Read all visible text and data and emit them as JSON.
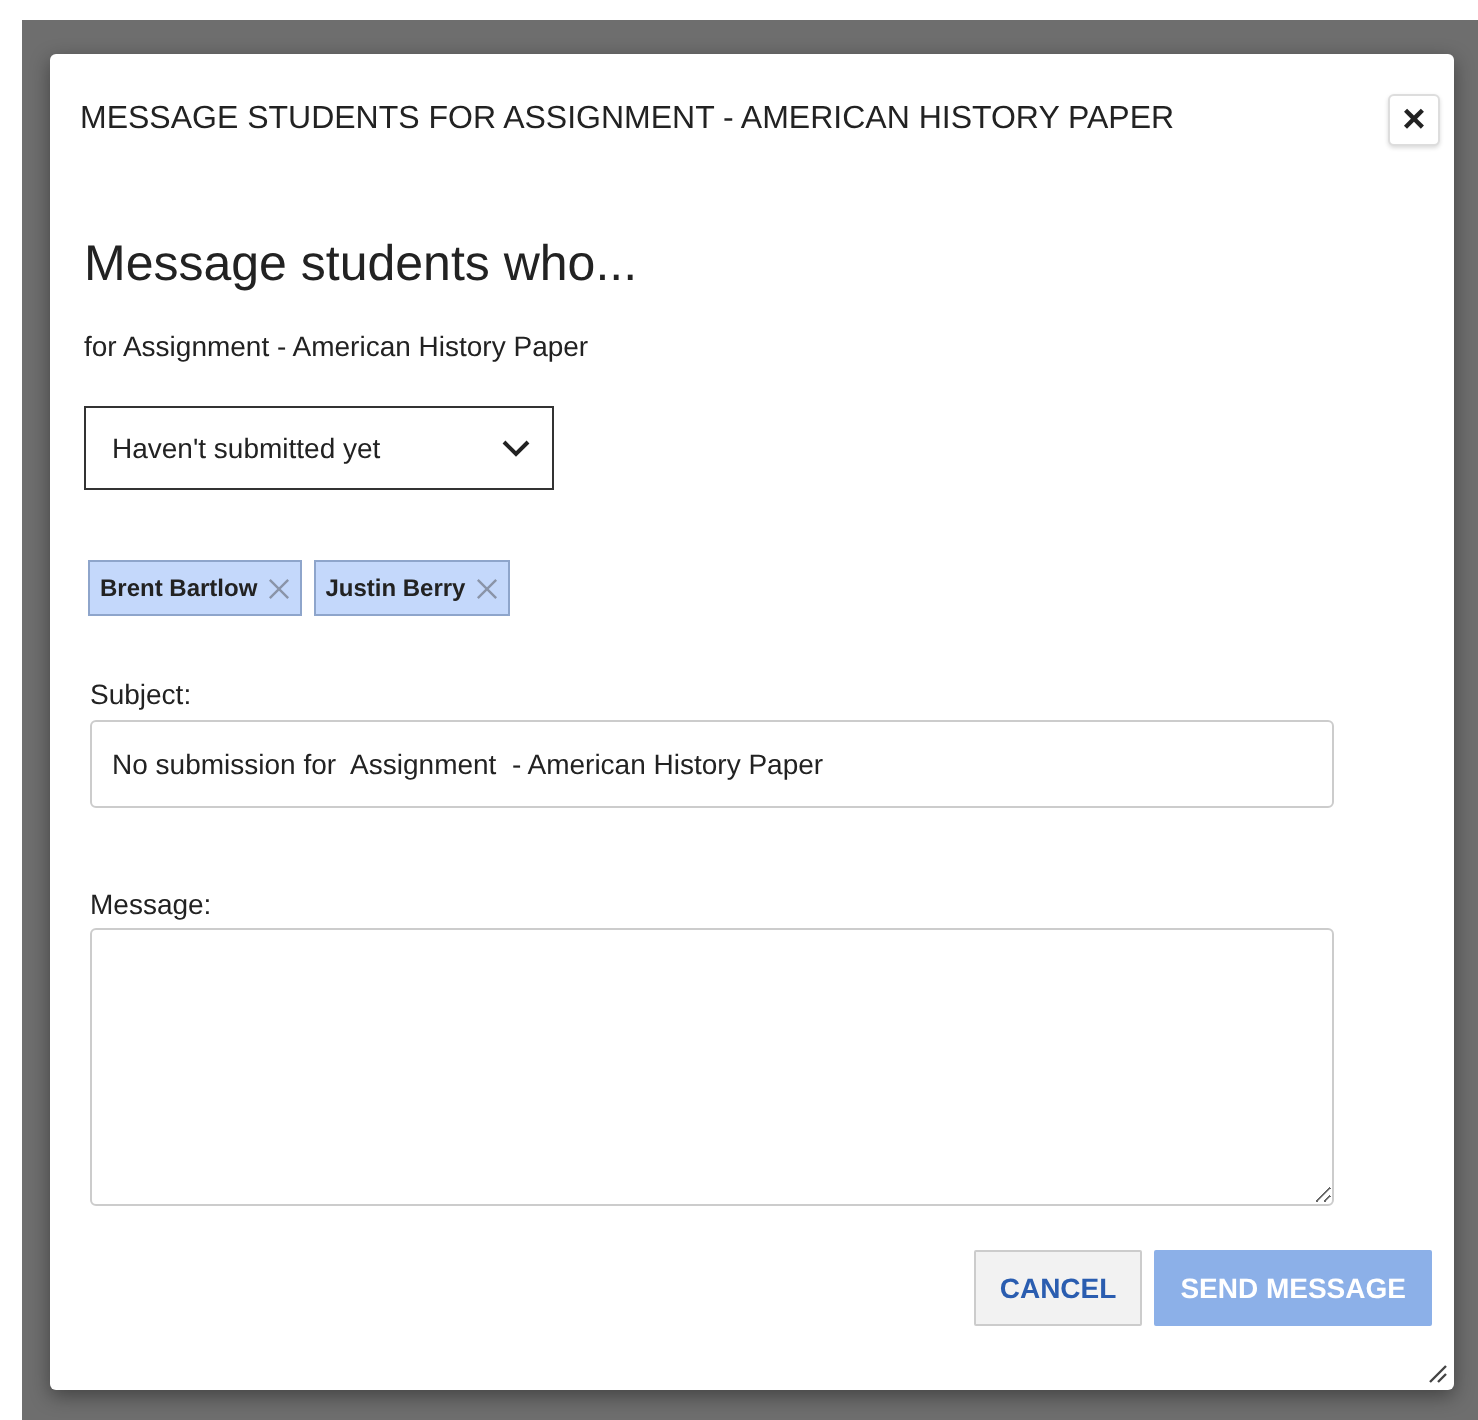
{
  "dialog": {
    "title": "MESSAGE STUDENTS FOR ASSIGNMENT - AMERICAN HISTORY PAPER",
    "close": "×"
  },
  "heading": "Message students who...",
  "subtitle": "for Assignment - American History Paper",
  "filter": {
    "value": "Haven't submitted yet"
  },
  "recipients": [
    {
      "name": "Brent Bartlow"
    },
    {
      "name": "Justin Berry"
    }
  ],
  "subject": {
    "label": "Subject:",
    "value": "No submission for  Assignment  - American History Paper"
  },
  "message": {
    "label": "Message:"
  },
  "buttons": [
    {
      "label": "CANCEL",
      "kind": "secondary",
      "disabled": false
    },
    {
      "label": "SEND MESSAGE",
      "kind": "primary",
      "disabled": true
    }
  ]
}
